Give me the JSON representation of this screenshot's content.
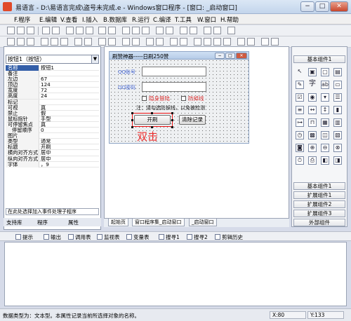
{
  "window": {
    "title": "易语言 - D:\\易语言完成\\盗号未完成.e - Windows窗口程序 - [窗口: _启动窗口]",
    "min": "−",
    "max": "□",
    "close": "✕"
  },
  "menu": [
    "F.程序",
    "E.编辑",
    "V.查看",
    "I.插入",
    "B.数据库",
    "R.运行",
    "C.编译",
    "T.工具",
    "W.窗口",
    "H.帮助"
  ],
  "left": {
    "combo": "按钮1（按钮）",
    "props": [
      {
        "n": "名称",
        "v": "按钮1"
      },
      {
        "n": "备注",
        "v": ""
      },
      {
        "n": "左边",
        "v": "67"
      },
      {
        "n": "顶边",
        "v": "124"
      },
      {
        "n": "宽度",
        "v": "72"
      },
      {
        "n": "高度",
        "v": "24"
      },
      {
        "n": "标记",
        "v": ""
      },
      {
        "n": "可视",
        "v": "真"
      },
      {
        "n": "禁止",
        "v": "假"
      },
      {
        "n": "鼠标指针",
        "v": "手型"
      },
      {
        "n": "可停留焦点",
        "v": "真"
      },
      {
        "n": "停留顺序",
        "v": "0"
      },
      {
        "n": "图片",
        "v": ""
      },
      {
        "n": "类型",
        "v": "通常"
      },
      {
        "n": "标题",
        "v": "开刷"
      },
      {
        "n": "横向对齐方式",
        "v": "居中"
      },
      {
        "n": "纵向对齐方式",
        "v": "居中"
      },
      {
        "n": "字体",
        "v": "，9"
      }
    ],
    "hint": "在此处选择加入事件处理子程序",
    "tabs": [
      "支持库",
      "程序",
      "属性"
    ]
  },
  "form": {
    "title": "刷赞神器-----日刷250赞",
    "qq_label": "QQ账号",
    "pwd_label": "QQ密码",
    "cb1": "隐身登陆",
    "cb2": "防掉线",
    "note": "注：请勾选防掉线，以免被检测",
    "btn_start": "开刷",
    "btn_clear": "清除记录",
    "annotation": "双击"
  },
  "center_tabs": [
    "起始页",
    "窗口程序集_启动窗口",
    "_启动窗口"
  ],
  "right": {
    "header": "基本组件1",
    "groups": [
      "基本组件1",
      "扩展组件1",
      "扩展组件2",
      "扩展组件3",
      "外部组件"
    ]
  },
  "bottom_tabs": [
    "提示",
    "输出",
    "调用表",
    "监视表",
    "变量表",
    "搜寻1",
    "搜寻2",
    "剪辑历史"
  ],
  "status": {
    "text": "数据类型为：文本型。本属性记录当前所选择对象的名称。",
    "x": "X:80",
    "y": "Y:133"
  }
}
